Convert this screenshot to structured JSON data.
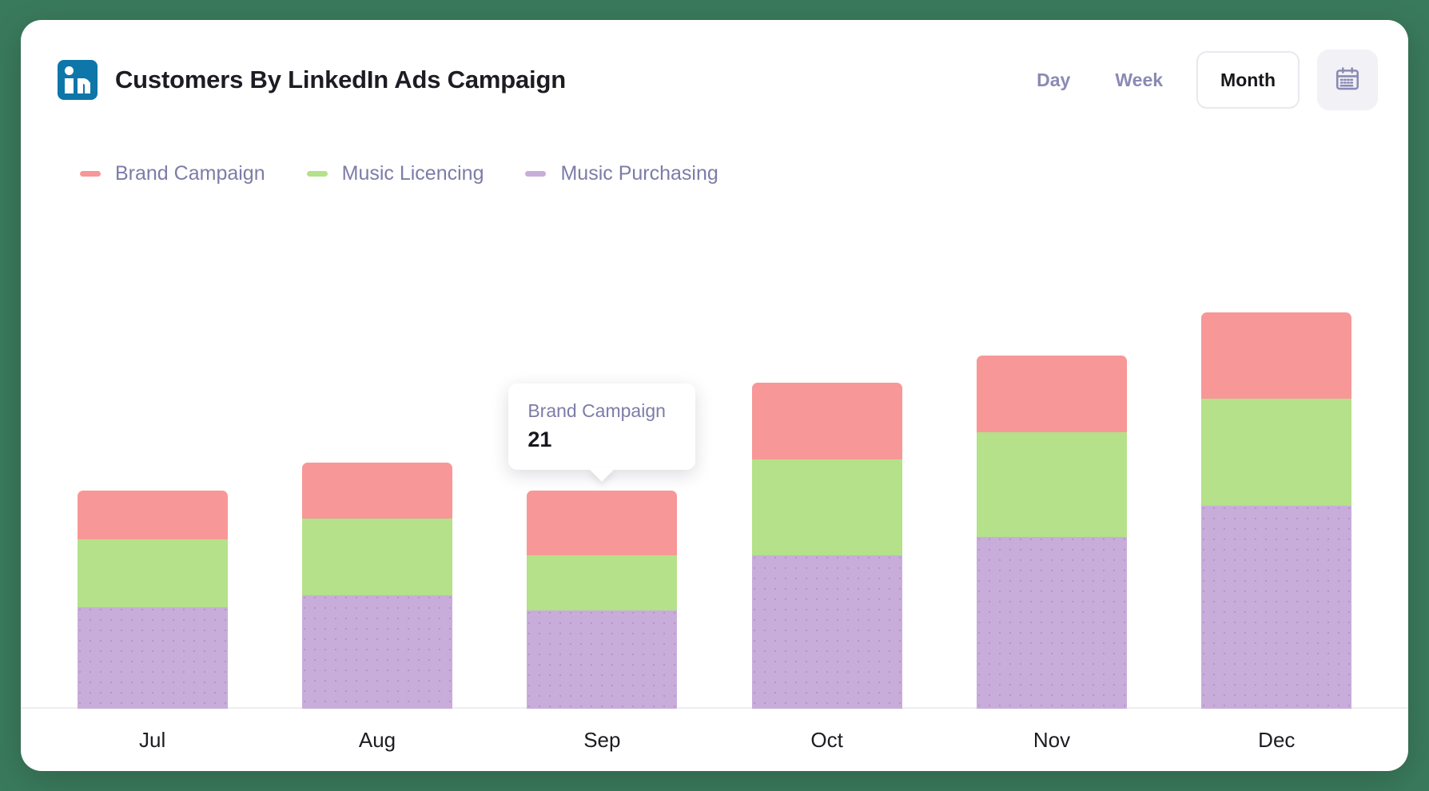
{
  "header": {
    "logo_icon": "linkedin-icon",
    "title": "Customers By LinkedIn Ads Campaign",
    "ranges": [
      {
        "label": "Day",
        "active": false
      },
      {
        "label": "Week",
        "active": false
      },
      {
        "label": "Month",
        "active": true
      }
    ],
    "calendar_icon": "calendar-icon"
  },
  "tooltip": {
    "label": "Brand Campaign",
    "value": "21"
  },
  "colors": {
    "brand_campaign": "#f89797",
    "music_licencing": "#b4e189",
    "music_purchasing": "#c8adda",
    "accent_text": "#7c7ca8",
    "linkedin_blue": "#0e76a8",
    "title_text": "#1c1c22",
    "baseline": "#eeeef2",
    "calendar_button_bg": "#f1f1f6"
  },
  "chart_data": {
    "type": "bar",
    "stacked": true,
    "title": "Customers By LinkedIn Ads Campaign",
    "xlabel": "",
    "ylabel": "",
    "grid": false,
    "legend_position": "top-left",
    "axis_labels_visible": false,
    "ylim": [
      0,
      130
    ],
    "categories": [
      "Jul",
      "Aug",
      "Sep",
      "Oct",
      "Nov",
      "Dec"
    ],
    "series": [
      {
        "name": "Music Purchasing",
        "color": "#c8adda",
        "values": [
          33,
          37,
          32,
          50,
          56,
          66
        ]
      },
      {
        "name": "Music Licencing",
        "color": "#b4e189",
        "values": [
          22,
          25,
          18,
          31,
          34,
          35
        ]
      },
      {
        "name": "Brand Campaign",
        "color": "#f89797",
        "values": [
          16,
          18,
          21,
          25,
          25,
          28
        ]
      }
    ],
    "totals": [
      71,
      80,
      71,
      106,
      115,
      129
    ],
    "highlighted": {
      "category": "Sep",
      "series": "Brand Campaign",
      "value": 21
    }
  },
  "legend": [
    {
      "label": "Brand Campaign",
      "color": "#f89797"
    },
    {
      "label": "Music Licencing",
      "color": "#b4e189"
    },
    {
      "label": "Music Purchasing",
      "color": "#c8adda"
    }
  ]
}
